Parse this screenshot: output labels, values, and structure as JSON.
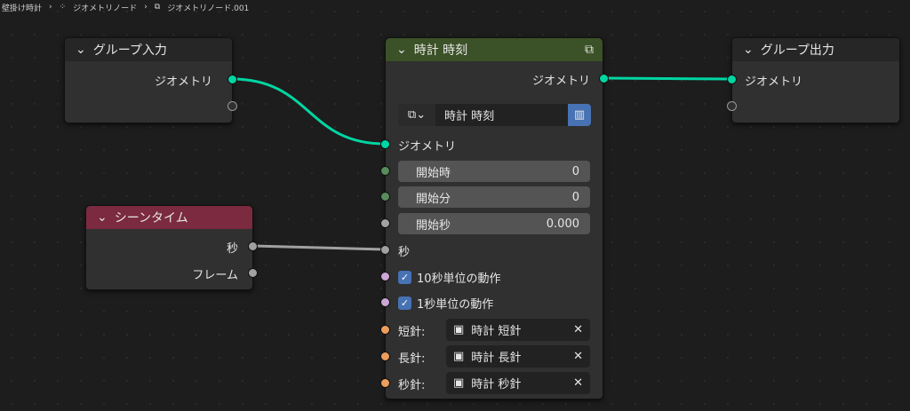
{
  "breadcrumb": [
    "壁掛け時計",
    "ジオメトリノード",
    "ジオメトリノード.001"
  ],
  "group_input": {
    "title": "グループ入力",
    "outputs": [
      "ジオメトリ"
    ]
  },
  "group_output": {
    "title": "グループ出力",
    "inputs": [
      "ジオメトリ"
    ]
  },
  "scene_time": {
    "title": "シーンタイム",
    "outputs": [
      "秒",
      "フレーム"
    ]
  },
  "clock": {
    "title": "時計 時刻",
    "output": "ジオメトリ",
    "node_group": "時計 時刻",
    "inputs": {
      "geometry": "ジオメトリ",
      "start_hour": {
        "label": "開始時",
        "value": "0"
      },
      "start_min": {
        "label": "開始分",
        "value": "0"
      },
      "start_sec": {
        "label": "開始秒",
        "value": "0.000"
      },
      "seconds": "秒",
      "check10": {
        "label": "10秒単位の動作",
        "checked": true
      },
      "check1": {
        "label": "1秒単位の動作",
        "checked": true
      },
      "short": {
        "label": "短針:",
        "object": "時計 短針"
      },
      "long": {
        "label": "長針:",
        "object": "時計 長針"
      },
      "sec": {
        "label": "秒針:",
        "object": "時計 秒針"
      }
    }
  },
  "colors": {
    "geometry": "#00d6a3",
    "float": "#a1a1a1",
    "int": "#598c5c",
    "bool": "#cca6d6",
    "object": "#ed9e5c",
    "clock_header": "#3b5127",
    "scene_header": "#7b2a3f"
  }
}
